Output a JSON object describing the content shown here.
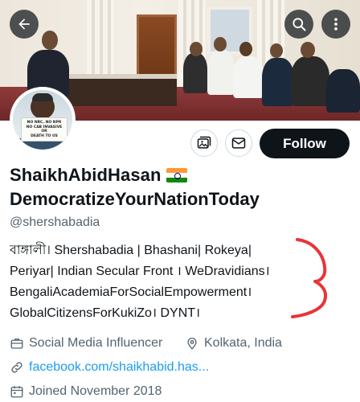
{
  "banner": {
    "back_icon": "arrow-left-icon",
    "search_icon": "search-icon",
    "more_icon": "more-vertical-icon"
  },
  "avatar": {
    "sign_lines": [
      "NO NRC, NO NPR",
      "NO CAB INVASIVE",
      "OR",
      "DEATH TO US"
    ]
  },
  "actions": {
    "media_icon": "media-icon",
    "message_icon": "mail-icon",
    "follow_label": "Follow"
  },
  "profile": {
    "name_line1": "ShaikhAbidHasan",
    "name_line2": "DemocratizeYourNationToday",
    "flag_icon": "india-flag-icon",
    "handle": "@shershabadia",
    "bio_lines": [
      "বাঙ্গালী। Shershabadia | Bhashani| Rokeya|",
      "Periyar| Indian Secular Front । WeDravidians।",
      "BengaliAcademiaForSocialEmpowerment।",
      "GlobalCitizensForKukiZo। DYNT।"
    ],
    "category": "Social Media Influencer",
    "location": "Kolkata, India",
    "website": "facebook.com/shaikhabid.has...",
    "joined": "Joined November 2018"
  },
  "colors": {
    "follow_bg": "#0f1419",
    "link": "#1d9bf0",
    "secondary_text": "#536471",
    "annotation_red": "#e8343a"
  }
}
